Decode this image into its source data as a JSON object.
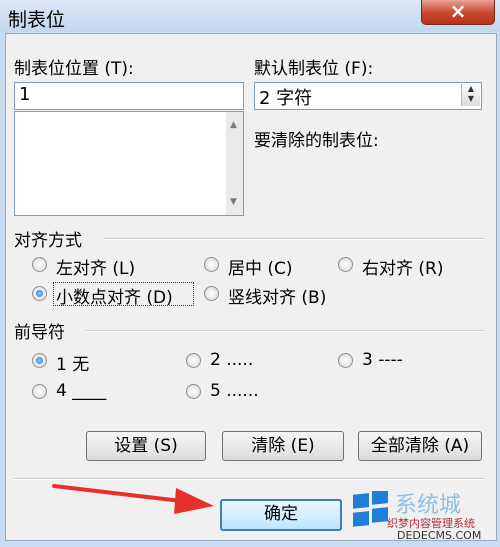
{
  "window": {
    "title": "制表位",
    "close_symbol": "×"
  },
  "tab_position": {
    "label": "制表位位置 (T):",
    "value": "1",
    "list_items": []
  },
  "default_tab": {
    "label": "默认制表位 (F):",
    "value": "2 字符"
  },
  "clear_label": "要清除的制表位:",
  "alignment": {
    "label": "对齐方式",
    "options": [
      "左对齐 (L)",
      "居中 (C)",
      "右对齐 (R)",
      "小数点对齐 (D)",
      "竖线对齐 (B)"
    ],
    "selected": "小数点对齐 (D)"
  },
  "leader": {
    "label": "前导符",
    "options": [
      "1 无",
      "2 .....",
      "3 ----",
      "4 ____",
      "5 ......"
    ],
    "selected": "1 无"
  },
  "buttons": {
    "set": "设置 (S)",
    "clear": "清除 (E)",
    "clear_all": "全部清除 (A)",
    "ok": "确定"
  },
  "watermark": {
    "site_text": "系统城",
    "sub_text": "织梦内容管理系统",
    "url_text": "DEDECMS.COM"
  },
  "colors": {
    "titlebar": "#c9dcf2",
    "close_button": "#c8452f",
    "default_button_border": "#3c7fb1",
    "arrow": "#e8302a"
  }
}
